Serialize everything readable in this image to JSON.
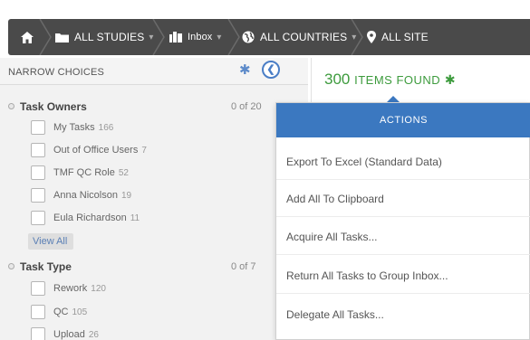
{
  "breadcrumb": {
    "home_icon": "home-icon",
    "studies_label": "ALL STUDIES",
    "inbox_label": "Inbox",
    "countries_label": "ALL COUNTRIES",
    "sites_label": "ALL SITE"
  },
  "narrow": {
    "title": "NARROW CHOICES",
    "task_owners": {
      "title": "Task Owners",
      "count": "0 of 20",
      "items": [
        {
          "label": "My Tasks",
          "count": "166"
        },
        {
          "label": "Out of Office Users",
          "count": "7"
        },
        {
          "label": "TMF QC Role",
          "count": "52"
        },
        {
          "label": "Anna Nicolson",
          "count": "19"
        },
        {
          "label": "Eula Richardson",
          "count": "11"
        }
      ],
      "view_all": "View All"
    },
    "task_type": {
      "title": "Task Type",
      "count": "0 of 7",
      "items": [
        {
          "label": "Rework",
          "count": "120"
        },
        {
          "label": "QC",
          "count": "105"
        },
        {
          "label": "Upload",
          "count": "26"
        }
      ]
    }
  },
  "results": {
    "count": "300",
    "label": "Items Found"
  },
  "actions": {
    "header": "ACTIONS",
    "items": [
      "Export To Excel (Standard Data)",
      "Add All To Clipboard",
      "Acquire All Tasks...",
      "Return All Tasks to Group Inbox...",
      "Delegate All Tasks..."
    ]
  },
  "colors": {
    "breadcrumb_bg": "#4a4a4a",
    "accent_blue": "#3b78c0",
    "found_green": "#3d9b3d"
  }
}
